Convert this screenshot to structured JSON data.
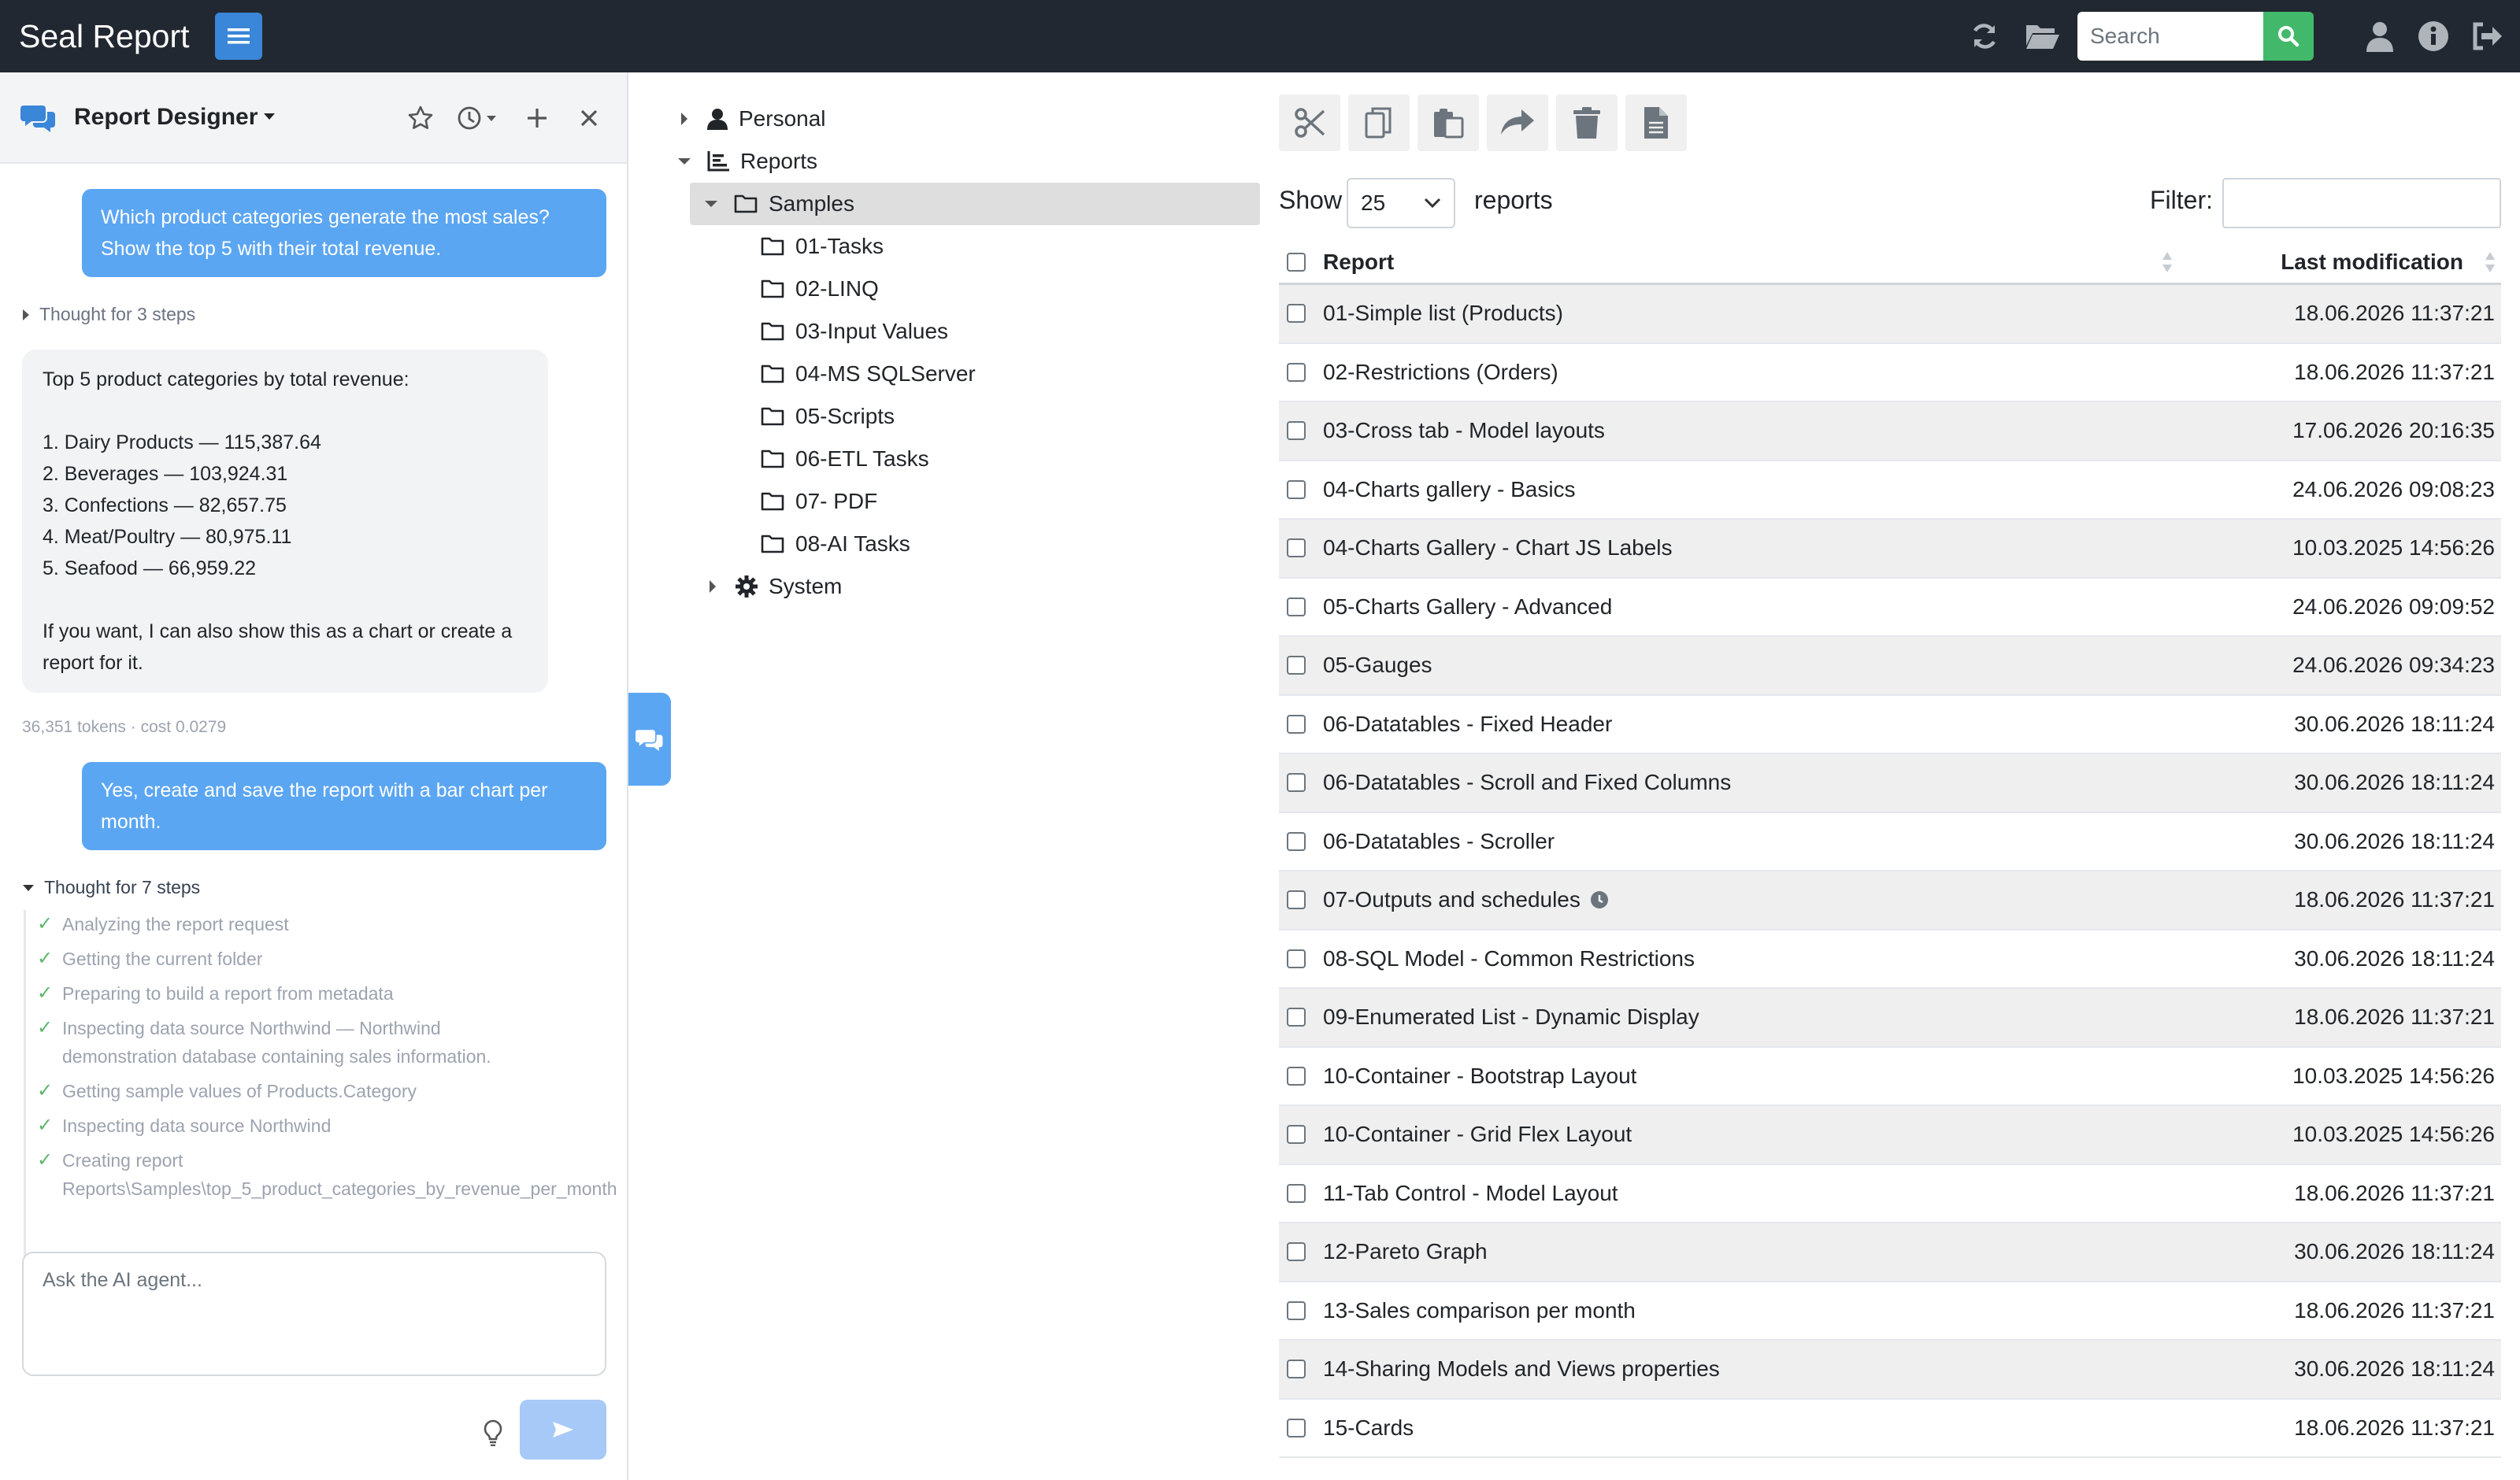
{
  "navbar": {
    "brand": "Seal Report",
    "search_placeholder": "Search"
  },
  "ai_panel": {
    "title": "Report Designer",
    "messages": {
      "user1": "Which product categories generate the most sales? Show the top 5 with their total revenue.",
      "thought1": "Thought for 3 steps",
      "assistant1": "Top 5 product categories by total revenue:\n\n1. Dairy Products — 115,387.64\n2. Beverages — 103,924.31\n3. Confections — 82,657.75\n4. Meat/Poultry — 80,975.11\n5. Seafood — 66,959.22\n\nIf you want, I can also show this as a chart or create a report for it.",
      "tokens": "36,351 tokens · cost 0.0279",
      "user2": "Yes, create and save the report with a bar chart per month.",
      "thought2": "Thought for 7 steps"
    },
    "steps": [
      "Analyzing the report request",
      "Getting the current folder",
      "Preparing to build a report from metadata",
      "Inspecting data source Northwind — Northwind\ndemonstration database containing sales information.",
      "Getting sample values of Products.Category",
      "Inspecting data source Northwind",
      "Creating report\nReports\\Samples\\top_5_product_categories_by_revenue_per_month"
    ],
    "input_placeholder": "Ask the AI agent..."
  },
  "tree": {
    "personal": "Personal",
    "reports": "Reports",
    "samples": "Samples",
    "folders": [
      "01-Tasks",
      "02-LINQ",
      "03-Input Values",
      "04-MS SQLServer",
      "05-Scripts",
      "06-ETL Tasks",
      "07- PDF",
      "08-AI Tasks"
    ],
    "system": "System"
  },
  "list": {
    "show_label": "Show",
    "page_size": "25",
    "reports_label": "reports",
    "filter_label": "Filter:",
    "col_report": "Report",
    "col_modified": "Last modification",
    "rows": [
      {
        "name": "01-Simple list (Products)",
        "date": "18.06.2026 11:37:21"
      },
      {
        "name": "02-Restrictions (Orders)",
        "date": "18.06.2026 11:37:21"
      },
      {
        "name": "03-Cross tab - Model layouts",
        "date": "17.06.2026 20:16:35"
      },
      {
        "name": "04-Charts gallery - Basics",
        "date": "24.06.2026 09:08:23"
      },
      {
        "name": "04-Charts Gallery - Chart JS Labels",
        "date": "10.03.2025 14:56:26"
      },
      {
        "name": "05-Charts Gallery - Advanced",
        "date": "24.06.2026 09:09:52"
      },
      {
        "name": "05-Gauges",
        "date": "24.06.2026 09:34:23"
      },
      {
        "name": "06-Datatables - Fixed Header",
        "date": "30.06.2026 18:11:24"
      },
      {
        "name": "06-Datatables - Scroll and Fixed Columns",
        "date": "30.06.2026 18:11:24"
      },
      {
        "name": "06-Datatables - Scroller",
        "date": "30.06.2026 18:11:24"
      },
      {
        "name": "07-Outputs and schedules",
        "date": "18.06.2026 11:37:21",
        "scheduled": true
      },
      {
        "name": "08-SQL Model - Common Restrictions",
        "date": "30.06.2026 18:11:24"
      },
      {
        "name": "09-Enumerated List - Dynamic Display",
        "date": "18.06.2026 11:37:21"
      },
      {
        "name": "10-Container - Bootstrap Layout",
        "date": "10.03.2025 14:56:26"
      },
      {
        "name": "10-Container - Grid Flex Layout",
        "date": "10.03.2025 14:56:26"
      },
      {
        "name": "11-Tab Control - Model Layout",
        "date": "18.06.2026 11:37:21"
      },
      {
        "name": "12-Pareto Graph",
        "date": "30.06.2026 18:11:24"
      },
      {
        "name": "13-Sales comparison per month",
        "date": "18.06.2026 11:37:21"
      },
      {
        "name": "14-Sharing Models and Views properties",
        "date": "30.06.2026 18:11:24"
      },
      {
        "name": "15-Cards",
        "date": "18.06.2026 11:37:21"
      }
    ]
  }
}
